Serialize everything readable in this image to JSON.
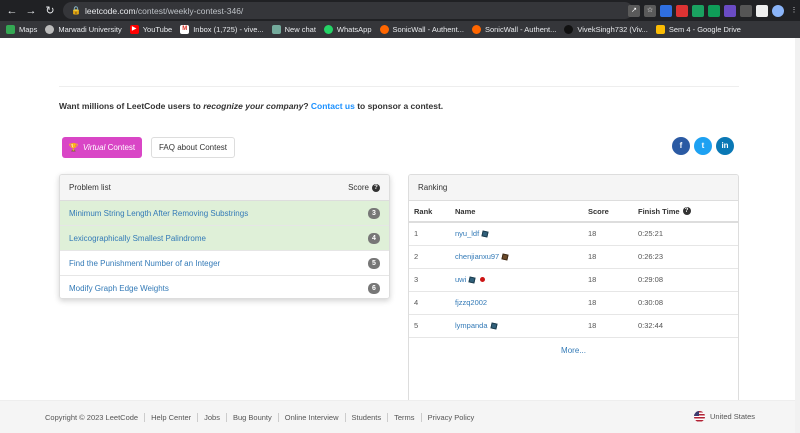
{
  "browser": {
    "url_host": "leetcode.com",
    "url_path": "/contest/weekly-contest-346/",
    "bookmarks": [
      "Maps",
      "Marwadi University",
      "YouTube",
      "Inbox (1,725) - vive...",
      "New chat",
      "WhatsApp",
      "SonicWall - Authent...",
      "SonicWall - Authent...",
      "VivekSingh732 (Viv...",
      "Sem 4 - Google Drive"
    ]
  },
  "sponsor": {
    "prefix": "Want millions of LeetCode users to ",
    "italic": "recognize your company",
    "mid": "? ",
    "link": "Contact us",
    "suffix": " to sponsor a contest."
  },
  "buttons": {
    "virtual_italic": "Virtual",
    "virtual_rest": "Contest",
    "faq": "FAQ about Contest"
  },
  "social": {
    "fb": "f",
    "tw": "t",
    "li": "in"
  },
  "problems": {
    "header": "Problem list",
    "score_header": "Score",
    "items": [
      {
        "title": "Minimum String Length After Removing Substrings",
        "score": "3"
      },
      {
        "title": "Lexicographically Smallest Palindrome",
        "score": "4"
      },
      {
        "title": "Find the Punishment Number of an Integer",
        "score": "5"
      },
      {
        "title": "Modify Graph Edge Weights",
        "score": "6"
      }
    ]
  },
  "ranking": {
    "header": "Ranking",
    "columns": [
      "Rank",
      "Name",
      "Score",
      "Finish Time"
    ],
    "rows": [
      {
        "rank": "1",
        "name": "nyu_ldf",
        "score": "18",
        "time": "0:25:21"
      },
      {
        "rank": "2",
        "name": "chenjianxu97",
        "score": "18",
        "time": "0:26:23"
      },
      {
        "rank": "3",
        "name": "uwi",
        "score": "18",
        "time": "0:29:08"
      },
      {
        "rank": "4",
        "name": "fjzzq2002",
        "score": "18",
        "time": "0:30:08"
      },
      {
        "rank": "5",
        "name": "lympanda",
        "score": "18",
        "time": "0:32:44"
      }
    ],
    "more": "More..."
  },
  "footer": {
    "links": [
      "Copyright © 2023 LeetCode",
      "Help Center",
      "Jobs",
      "Bug Bounty",
      "Online Interview",
      "Students",
      "Terms",
      "Privacy Policy"
    ],
    "language": "United States"
  }
}
